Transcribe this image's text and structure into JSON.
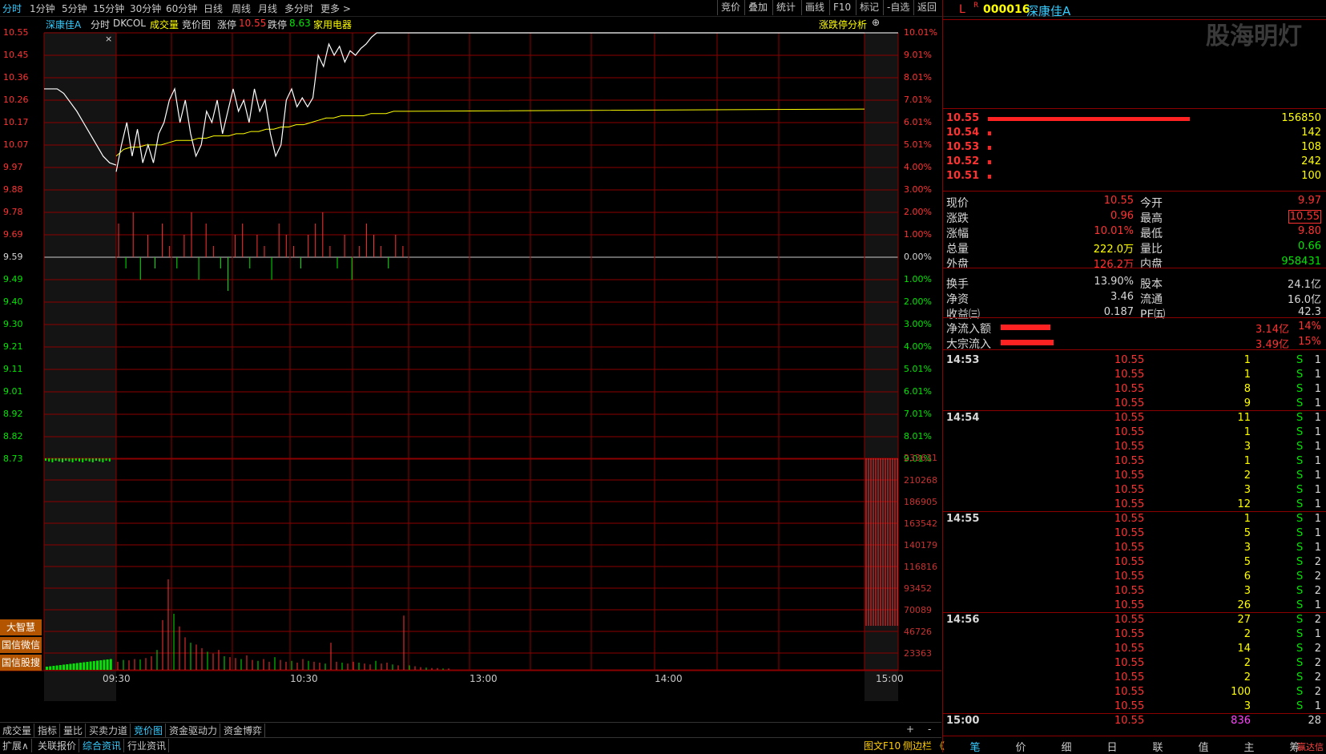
{
  "toolbar": {
    "periods": [
      "分时",
      "1分钟",
      "5分钟",
      "15分钟",
      "30分钟",
      "60分钟",
      "日线",
      "周线",
      "月线",
      "多分时",
      "更多 >"
    ],
    "right_buttons": [
      "竞价",
      "叠加",
      "统计",
      "画线",
      "F10",
      "标记",
      "-自选",
      "返回"
    ]
  },
  "chart_info": {
    "stock_name": "深康佳A",
    "mode": "分时",
    "indicator": "DKCOL",
    "volume_label": "成交量",
    "auction_label": "竞价图",
    "limit_up_label": "涨停",
    "limit_up_value": "10.55",
    "limit_down_label": "跌停",
    "limit_down_value": "8.63",
    "sector": "家用电器",
    "analysis_label": "涨跌停分析"
  },
  "chart_data": {
    "type": "line",
    "price_ticks": [
      "10.55",
      "10.45",
      "10.36",
      "10.26",
      "10.17",
      "10.07",
      "9.97",
      "9.88",
      "9.78",
      "9.69",
      "9.59",
      "9.49",
      "9.40",
      "9.30",
      "9.21",
      "9.11",
      "9.01",
      "8.92",
      "8.82",
      "8.73"
    ],
    "pct_ticks": [
      "10.01%",
      "9.01%",
      "8.01%",
      "7.01%",
      "6.01%",
      "5.01%",
      "4.00%",
      "3.00%",
      "2.00%",
      "1.00%",
      "0.00%",
      "1.00%",
      "2.00%",
      "3.00%",
      "4.00%",
      "5.01%",
      "6.01%",
      "7.01%",
      "8.01%",
      "9.01%"
    ],
    "volume_ticks": [
      "233631",
      "210268",
      "186905",
      "163542",
      "140179",
      "116816",
      "93452",
      "70089",
      "46726",
      "23363"
    ],
    "time_labels": [
      "09:30",
      "10:30",
      "13:00",
      "14:00",
      "15:00"
    ],
    "prev_close": 9.59,
    "price_range": [
      8.63,
      10.55
    ],
    "volume_max": 233631,
    "auction_price": [
      10.3,
      10.3,
      10.3,
      10.28,
      10.24,
      10.2,
      10.15,
      10.1,
      10.05,
      10.0,
      9.97,
      9.96
    ],
    "price": [
      9.93,
      10.05,
      10.15,
      10.0,
      10.12,
      9.97,
      10.05,
      9.97,
      10.1,
      10.15,
      10.25,
      10.3,
      10.15,
      10.25,
      10.1,
      10.0,
      10.05,
      10.2,
      10.15,
      10.25,
      10.1,
      10.2,
      10.3,
      10.2,
      10.25,
      10.15,
      10.3,
      10.2,
      10.25,
      10.1,
      10.0,
      10.05,
      10.25,
      10.3,
      10.22,
      10.26,
      10.22,
      10.26,
      10.45,
      10.4,
      10.5,
      10.45,
      10.49,
      10.42,
      10.47,
      10.45,
      10.48,
      10.5,
      10.53,
      10.55,
      10.55,
      10.55,
      10.55,
      10.55,
      10.55,
      10.55
    ],
    "avg_price": [
      10.0,
      10.03,
      10.04,
      10.04,
      10.05,
      10.05,
      10.05,
      10.06,
      10.07,
      10.07,
      10.07,
      10.08,
      10.08,
      10.09,
      10.09,
      10.09,
      10.1,
      10.1,
      10.11,
      10.11,
      10.12,
      10.12,
      10.13,
      10.13,
      10.14,
      10.14,
      10.15,
      10.16,
      10.17,
      10.17,
      10.18,
      10.18,
      10.18,
      10.18,
      10.19,
      10.19,
      10.19,
      10.2,
      10.2,
      10.2
    ],
    "macd_bars": [
      3,
      -1,
      4,
      -2,
      2,
      -1,
      3,
      1,
      -1,
      2,
      4,
      -2,
      3,
      1,
      -1,
      -3,
      2,
      3,
      -1,
      2,
      1,
      -2,
      3,
      2,
      1,
      -1,
      2,
      3,
      4,
      1,
      -1,
      2,
      -2,
      1,
      3,
      2,
      1,
      -1,
      2,
      1
    ],
    "volume": [
      9000,
      11000,
      10500,
      12000,
      11500,
      13000,
      15000,
      22000,
      55000,
      100000,
      62000,
      48000,
      36000,
      30000,
      28000,
      24000,
      20000,
      18000,
      22000,
      15000,
      14000,
      13000,
      12000,
      16000,
      11000,
      10000,
      12000,
      9000,
      14000,
      11000,
      9000,
      10000,
      8000,
      12000,
      10000,
      9000,
      8000,
      7000,
      30000,
      9000,
      8000,
      7000,
      9000,
      8000,
      7000,
      6000,
      10000,
      7000,
      8000,
      6000,
      5000,
      60000,
      5000,
      4000,
      3000,
      2500,
      2000,
      2000,
      1500,
      1500
    ],
    "closing_auction_volume": 185000
  },
  "side_buttons": [
    "大智慧",
    "国信微信",
    "国信股搜"
  ],
  "bottom_tabs_row1": [
    "成交量",
    "指标",
    "量比",
    "买卖力道",
    "竞价图",
    "资金驱动力",
    "资金博弈"
  ],
  "bottom_tabs_row2": [
    "扩展∧",
    "关联报价",
    "综合资讯",
    "行业资讯"
  ],
  "bottom_tab_icons": [
    "+",
    "-"
  ],
  "bottom_right_links": [
    "图文F10",
    "侧边栏 《"
  ],
  "quote": {
    "flags": [
      "L",
      "R"
    ],
    "code": "000016",
    "name": "深康佳A",
    "watermark": "股海明灯",
    "bids": [
      {
        "price": "10.55",
        "vol": "156850",
        "bar": 0.6
      },
      {
        "price": "10.54",
        "vol": "142",
        "bar": 0.01
      },
      {
        "price": "10.53",
        "vol": "108",
        "bar": 0.01
      },
      {
        "price": "10.52",
        "vol": "242",
        "bar": 0.01
      },
      {
        "price": "10.51",
        "vol": "100",
        "bar": 0.01
      }
    ],
    "stats": [
      {
        "l1": "现价",
        "v1": "10.55",
        "c1": "red",
        "l2": "今开",
        "v2": "9.97",
        "c2": "red"
      },
      {
        "l1": "涨跌",
        "v1": "0.96",
        "c1": "red",
        "l2": "最高",
        "v2": "10.55",
        "c2": "red"
      },
      {
        "l1": "涨幅",
        "v1": "10.01%",
        "c1": "red",
        "l2": "最低",
        "v2": "9.80",
        "c2": "red"
      },
      {
        "l1": "总量",
        "v1": "222.0万",
        "c1": "yellow",
        "l2": "量比",
        "v2": "0.66",
        "c2": "green"
      },
      {
        "l1": "外盘",
        "v1": "126.2万",
        "c1": "red",
        "l2": "内盘",
        "v2": "958431",
        "c2": "green"
      },
      {
        "l1": "换手",
        "v1": "13.90%",
        "c1": "white",
        "l2": "股本",
        "v2": "24.1亿",
        "c2": "white"
      },
      {
        "l1": "净资",
        "v1": "3.46",
        "c1": "white",
        "l2": "流通",
        "v2": "16.0亿",
        "c2": "white"
      },
      {
        "l1": "收益㈢",
        "v1": "0.187",
        "c1": "white",
        "l2": "PE㈤",
        "v2": "42.3",
        "c2": "white"
      }
    ],
    "flows": [
      {
        "label": "净流入额",
        "value": "3.14亿",
        "pct": "14%",
        "bar": 0.14
      },
      {
        "label": "大宗流入",
        "value": "3.49亿",
        "pct": "15%",
        "bar": 0.15
      }
    ],
    "ticks": [
      {
        "time": "14:53",
        "price": "10.55",
        "vol": "1",
        "side": "S",
        "n": "1"
      },
      {
        "time": "",
        "price": "10.55",
        "vol": "1",
        "side": "S",
        "n": "1"
      },
      {
        "time": "",
        "price": "10.55",
        "vol": "8",
        "side": "S",
        "n": "1"
      },
      {
        "time": "",
        "price": "10.55",
        "vol": "9",
        "side": "S",
        "n": "1"
      },
      {
        "time": "14:54",
        "price": "10.55",
        "vol": "11",
        "side": "S",
        "n": "1"
      },
      {
        "time": "",
        "price": "10.55",
        "vol": "1",
        "side": "S",
        "n": "1"
      },
      {
        "time": "",
        "price": "10.55",
        "vol": "3",
        "side": "S",
        "n": "1"
      },
      {
        "time": "",
        "price": "10.55",
        "vol": "1",
        "side": "S",
        "n": "1"
      },
      {
        "time": "",
        "price": "10.55",
        "vol": "2",
        "side": "S",
        "n": "1"
      },
      {
        "time": "",
        "price": "10.55",
        "vol": "3",
        "side": "S",
        "n": "1"
      },
      {
        "time": "",
        "price": "10.55",
        "vol": "12",
        "side": "S",
        "n": "1"
      },
      {
        "time": "14:55",
        "price": "10.55",
        "vol": "1",
        "side": "S",
        "n": "1"
      },
      {
        "time": "",
        "price": "10.55",
        "vol": "5",
        "side": "S",
        "n": "1"
      },
      {
        "time": "",
        "price": "10.55",
        "vol": "3",
        "side": "S",
        "n": "1"
      },
      {
        "time": "",
        "price": "10.55",
        "vol": "5",
        "side": "S",
        "n": "2"
      },
      {
        "time": "",
        "price": "10.55",
        "vol": "6",
        "side": "S",
        "n": "2"
      },
      {
        "time": "",
        "price": "10.55",
        "vol": "3",
        "side": "S",
        "n": "2"
      },
      {
        "time": "",
        "price": "10.55",
        "vol": "26",
        "side": "S",
        "n": "1"
      },
      {
        "time": "14:56",
        "price": "10.55",
        "vol": "27",
        "side": "S",
        "n": "2"
      },
      {
        "time": "",
        "price": "10.55",
        "vol": "2",
        "side": "S",
        "n": "1"
      },
      {
        "time": "",
        "price": "10.55",
        "vol": "14",
        "side": "S",
        "n": "2"
      },
      {
        "time": "",
        "price": "10.55",
        "vol": "2",
        "side": "S",
        "n": "2"
      },
      {
        "time": "",
        "price": "10.55",
        "vol": "2",
        "side": "S",
        "n": "2"
      },
      {
        "time": "",
        "price": "10.55",
        "vol": "100",
        "side": "S",
        "n": "2"
      },
      {
        "time": "",
        "price": "10.55",
        "vol": "3",
        "side": "S",
        "n": "1"
      },
      {
        "time": "15:00",
        "price": "10.55",
        "vol": "836",
        "side": "",
        "n": "28"
      }
    ],
    "bottom_tabs": [
      "笔",
      "价",
      "细",
      "日",
      "联",
      "值",
      "主",
      "筹"
    ],
    "corner_text": "赢达信"
  },
  "colors": {
    "up": "#ff3232",
    "down": "#00e600",
    "grid": "#8b0000",
    "accent": "#33ccff",
    "avg": "#ffff00"
  }
}
